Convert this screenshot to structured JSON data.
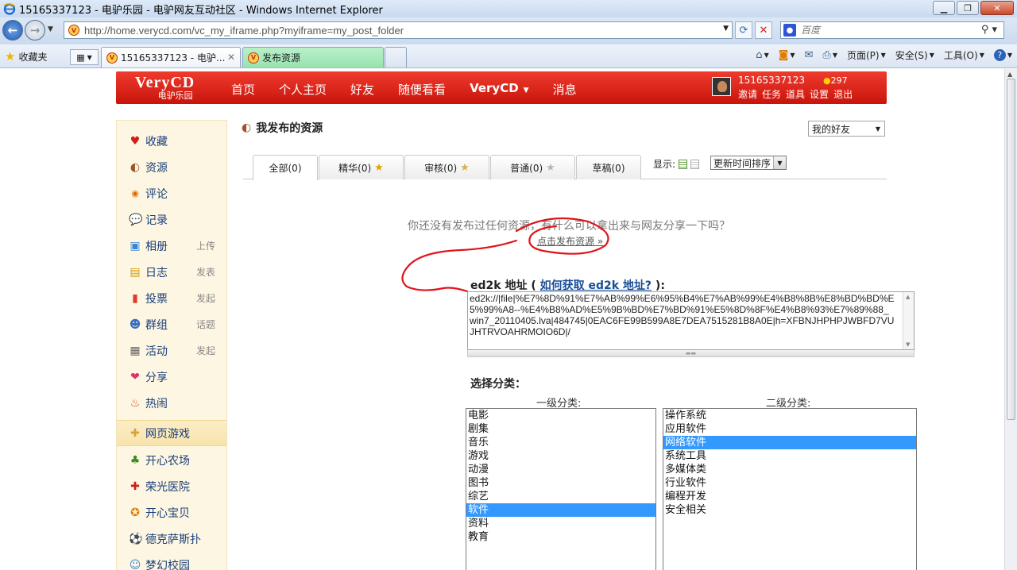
{
  "window": {
    "title": "15165337123 - 电驴乐园 - 电驴网友互动社区 - Windows Internet Explorer"
  },
  "address_bar": {
    "url": "http://home.verycd.com/vc_my_iframe.php?myiframe=my_post_folder",
    "search_placeholder": "百度"
  },
  "favorites_bar": {
    "favorites_label": "收藏夹",
    "tabs": [
      {
        "label": "15165337123 - 电驴..."
      },
      {
        "label": "发布资源"
      }
    ],
    "commands": [
      {
        "label": "页面(P)"
      },
      {
        "label": "安全(S)"
      },
      {
        "label": "工具(O)"
      }
    ]
  },
  "site": {
    "logo_top": "VeryCD",
    "logo_bottom": "电驴乐园",
    "nav": [
      {
        "label": "首页"
      },
      {
        "label": "个人主页"
      },
      {
        "label": "好友"
      },
      {
        "label": "随便看看"
      },
      {
        "label": "VeryCD"
      },
      {
        "label": "消息"
      }
    ],
    "user": {
      "name": "15165337123",
      "points": "297",
      "links": [
        {
          "label": "邀请"
        },
        {
          "label": "任务"
        },
        {
          "label": "道具"
        },
        {
          "label": "设置"
        },
        {
          "label": "退出"
        }
      ]
    }
  },
  "sidebar": {
    "items": [
      {
        "label": "收藏",
        "sub": "",
        "icon": "heart-icon"
      },
      {
        "label": "资源",
        "sub": "",
        "icon": "resource-icon"
      },
      {
        "label": "评论",
        "sub": "",
        "icon": "comment-icon"
      },
      {
        "label": "记录",
        "sub": "",
        "icon": "record-icon"
      },
      {
        "label": "相册",
        "sub": "上传",
        "icon": "album-icon"
      },
      {
        "label": "日志",
        "sub": "发表",
        "icon": "diary-icon"
      },
      {
        "label": "投票",
        "sub": "发起",
        "icon": "vote-icon"
      },
      {
        "label": "群组",
        "sub": "话题",
        "icon": "group-icon"
      },
      {
        "label": "活动",
        "sub": "发起",
        "icon": "calendar-icon"
      },
      {
        "label": "分享",
        "sub": "",
        "icon": "share-icon"
      },
      {
        "label": "热闹",
        "sub": "",
        "icon": "fire-icon"
      }
    ],
    "section_title": "网页游戏",
    "games": [
      {
        "label": "开心农场",
        "icon": "plant-icon"
      },
      {
        "label": "荣光医院",
        "icon": "hospital-icon"
      },
      {
        "label": "开心宝贝",
        "icon": "baby-icon"
      },
      {
        "label": "德克萨斯扑",
        "icon": "poker-icon"
      },
      {
        "label": "梦幻校园",
        "icon": "school-icon"
      }
    ]
  },
  "main": {
    "title": "我发布的资源",
    "friend_select": "我的好友",
    "tabs": [
      {
        "label": "全部(0)"
      },
      {
        "label": "精华(0)"
      },
      {
        "label": "审核(0)"
      },
      {
        "label": "普通(0)"
      },
      {
        "label": "草稿(0)"
      }
    ],
    "display_label": "显示:",
    "sort_select": "更新时间排序",
    "empty_message": "你还没有发布过任何资源，有什么可以拿出来与网友分享一下吗？",
    "publish_link": "点击发布资源 »",
    "ed2k": {
      "label": "ed2k 地址",
      "paren_open": "(",
      "help_link": "如何获取 ed2k 地址?",
      "paren_close": "):",
      "value": "ed2k://|file|%E7%8D%91%E7%AB%99%E6%95%B4%E7%AB%99%E4%B8%8B%E8%BD%BD%E5%99%A8--%E4%B8%AD%E5%9B%BD%E7%BD%91%E5%8D%8F%E4%B8%93%E7%89%88_win7_20110405.lva|484745|0EAC6FE99B599A8E7DEA7515281B8A0E|h=XFBNJHPHPJWBFD7VUJHTRVOAHRMOIO6D|/"
    },
    "category": {
      "label": "选择分类：",
      "level1_label": "一级分类:",
      "level2_label": "二级分类:",
      "level1": [
        {
          "label": "电影"
        },
        {
          "label": "剧集"
        },
        {
          "label": "音乐"
        },
        {
          "label": "游戏"
        },
        {
          "label": "动漫"
        },
        {
          "label": "图书"
        },
        {
          "label": "综艺"
        },
        {
          "label": "软件"
        },
        {
          "label": "资料"
        },
        {
          "label": "教育"
        }
      ],
      "level1_selected": "软件",
      "level2": [
        {
          "label": "操作系统"
        },
        {
          "label": "应用软件"
        },
        {
          "label": "网络软件"
        },
        {
          "label": "系统工具"
        },
        {
          "label": "多媒体类"
        },
        {
          "label": "行业软件"
        },
        {
          "label": "编程开发"
        },
        {
          "label": "安全相关"
        }
      ],
      "level2_selected": "网络软件"
    }
  },
  "colors": {
    "brand_red": "#d9180d",
    "selection_blue": "#3399ff",
    "annotation_red": "#e0141a"
  }
}
